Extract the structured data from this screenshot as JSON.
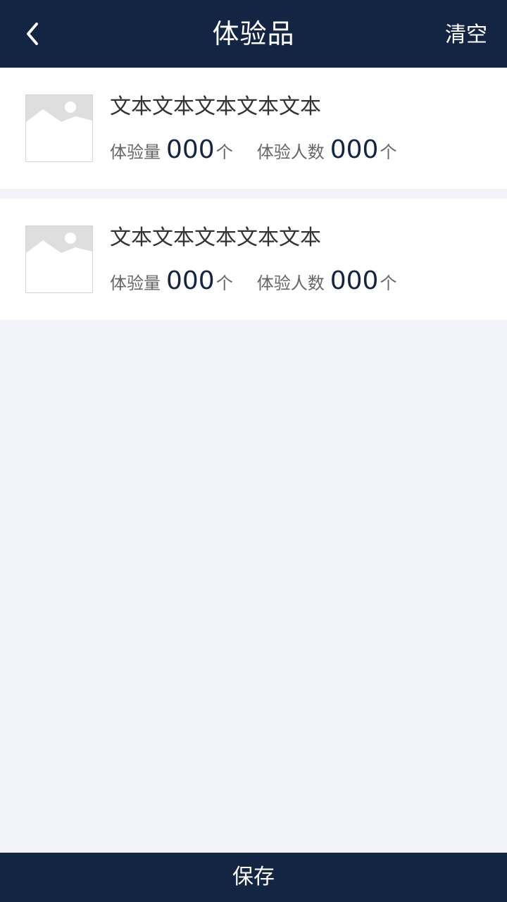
{
  "header": {
    "back_icon": "chevron-left-icon",
    "title": "体验品",
    "clear_label": "清空"
  },
  "items": [
    {
      "image_icon": "image-placeholder-icon",
      "title": "文本文本文本文本文本",
      "experience_label": "体验量",
      "experience_value": "000",
      "experience_unit": "个",
      "people_label": "体验人数",
      "people_value": "000",
      "people_unit": "个"
    },
    {
      "image_icon": "image-placeholder-icon",
      "title": "文本文本文本文本文本",
      "experience_label": "体验量",
      "experience_value": "000",
      "experience_unit": "个",
      "people_label": "体验人数",
      "people_value": "000",
      "people_unit": "个"
    }
  ],
  "footer": {
    "save_label": "保存"
  },
  "colors": {
    "header_bg": "#132543",
    "page_bg": "#f1f3f7",
    "card_bg": "#ffffff",
    "accent_value": "#132543"
  }
}
